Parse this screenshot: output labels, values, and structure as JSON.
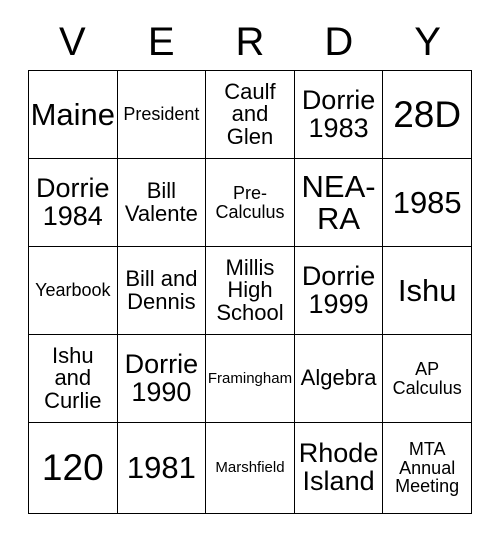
{
  "card": {
    "headers": [
      "V",
      "E",
      "R",
      "D",
      "Y"
    ],
    "rows": [
      [
        {
          "text": "Maine",
          "size": "fs-xl"
        },
        {
          "text": "President",
          "size": "fs-s"
        },
        {
          "text": "Caulf\nand\nGlen",
          "size": "fs-m"
        },
        {
          "text": "Dorrie\n1983",
          "size": "fs-l"
        },
        {
          "text": "28D",
          "size": "fs-xxl"
        }
      ],
      [
        {
          "text": "Dorrie\n1984",
          "size": "fs-l"
        },
        {
          "text": "Bill\nValente",
          "size": "fs-m"
        },
        {
          "text": "Pre-\nCalculus",
          "size": "fs-s"
        },
        {
          "text": "NEA-\nRA",
          "size": "fs-xl"
        },
        {
          "text": "1985",
          "size": "fs-xl"
        }
      ],
      [
        {
          "text": "Yearbook",
          "size": "fs-s"
        },
        {
          "text": "Bill and\nDennis",
          "size": "fs-m"
        },
        {
          "text": "Millis\nHigh\nSchool",
          "size": "fs-m"
        },
        {
          "text": "Dorrie\n1999",
          "size": "fs-l"
        },
        {
          "text": "Ishu",
          "size": "fs-xl"
        }
      ],
      [
        {
          "text": "Ishu\nand\nCurlie",
          "size": "fs-m"
        },
        {
          "text": "Dorrie\n1990",
          "size": "fs-l"
        },
        {
          "text": "Framingham",
          "size": "fs-xs"
        },
        {
          "text": "Algebra",
          "size": "fs-m"
        },
        {
          "text": "AP\nCalculus",
          "size": "fs-s"
        }
      ],
      [
        {
          "text": "120",
          "size": "fs-xxl"
        },
        {
          "text": "1981",
          "size": "fs-xl"
        },
        {
          "text": "Marshfield",
          "size": "fs-xs"
        },
        {
          "text": "Rhode\nIsland",
          "size": "fs-l"
        },
        {
          "text": "MTA\nAnnual\nMeeting",
          "size": "fs-s"
        }
      ]
    ]
  },
  "colors": {
    "background": "#ffffff",
    "border": "#000000",
    "text": "#000000"
  }
}
